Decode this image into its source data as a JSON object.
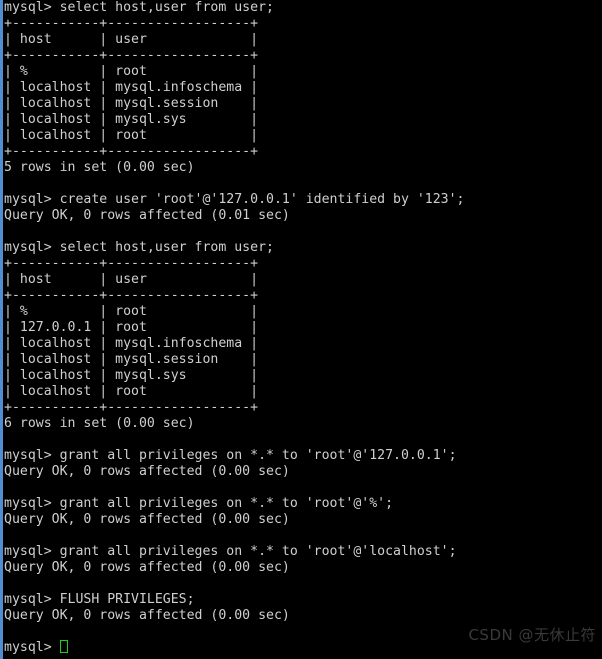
{
  "terminal": {
    "title": "mysql client terminal",
    "background_color": "#000000",
    "text_color": "#cfcfcf",
    "accent_bar_color": "#4f8fd0",
    "cursor_color": "#19d219",
    "prompt": "mysql>",
    "lines": [
      "mysql> select host,user from user;",
      "+-----------+------------------+",
      "| host      | user             |",
      "+-----------+------------------+",
      "| %         | root             |",
      "| localhost | mysql.infoschema |",
      "| localhost | mysql.session    |",
      "| localhost | mysql.sys        |",
      "| localhost | root             |",
      "+-----------+------------------+",
      "5 rows in set (0.00 sec)",
      "",
      "mysql> create user 'root'@'127.0.0.1' identified by '123';",
      "Query OK, 0 rows affected (0.01 sec)",
      "",
      "mysql> select host,user from user;",
      "+-----------+------------------+",
      "| host      | user             |",
      "+-----------+------------------+",
      "| %         | root             |",
      "| 127.0.0.1 | root             |",
      "| localhost | mysql.infoschema |",
      "| localhost | mysql.session    |",
      "| localhost | mysql.sys        |",
      "| localhost | root             |",
      "+-----------+------------------+",
      "6 rows in set (0.00 sec)",
      "",
      "mysql> grant all privileges on *.* to 'root'@'127.0.0.1';",
      "Query OK, 0 rows affected (0.00 sec)",
      "",
      "mysql> grant all privileges on *.* to 'root'@'%';",
      "Query OK, 0 rows affected (0.00 sec)",
      "",
      "mysql> grant all privileges on *.* to 'root'@'localhost';",
      "Query OK, 0 rows affected (0.00 sec)",
      "",
      "mysql> FLUSH PRIVILEGES;",
      "Query OK, 0 rows affected (0.00 sec)",
      ""
    ],
    "final_prompt": "mysql> "
  },
  "watermark": {
    "text": "CSDN @无休止符",
    "color": "#3a3a3a"
  }
}
